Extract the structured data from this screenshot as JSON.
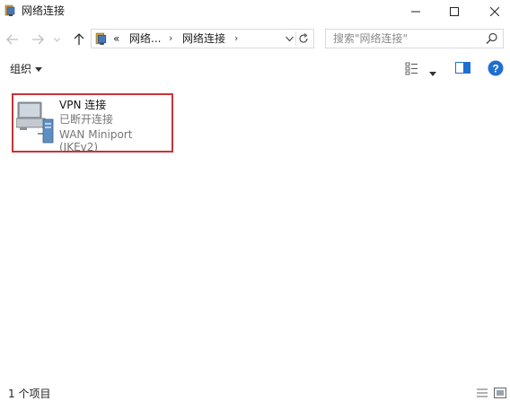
{
  "window": {
    "title": "网络连接",
    "controls": [
      "minimize",
      "maximize",
      "close"
    ]
  },
  "navigation": {
    "back_icon": "back-arrow-icon",
    "forward_icon": "forward-arrow-icon",
    "recent_icon": "chevron-down-icon",
    "up_icon": "up-arrow-icon",
    "address": {
      "overflow": "«",
      "crumbs": [
        "网络...",
        "网络连接"
      ]
    },
    "search_placeholder": "搜索\"网络连接\""
  },
  "toolbar": {
    "organize_label": "组织",
    "icons": [
      "change-view-icon",
      "preview-pane-icon",
      "help-icon"
    ]
  },
  "connections": [
    {
      "name": "VPN 连接",
      "status": "已断开连接",
      "device": "WAN Miniport (IKEv2)",
      "icon": "network-connection-icon"
    }
  ],
  "statusbar": {
    "count_text": "1 个项目"
  },
  "colors": {
    "selection_border": "#c8323a",
    "help_blue": "#1e6fd0"
  }
}
